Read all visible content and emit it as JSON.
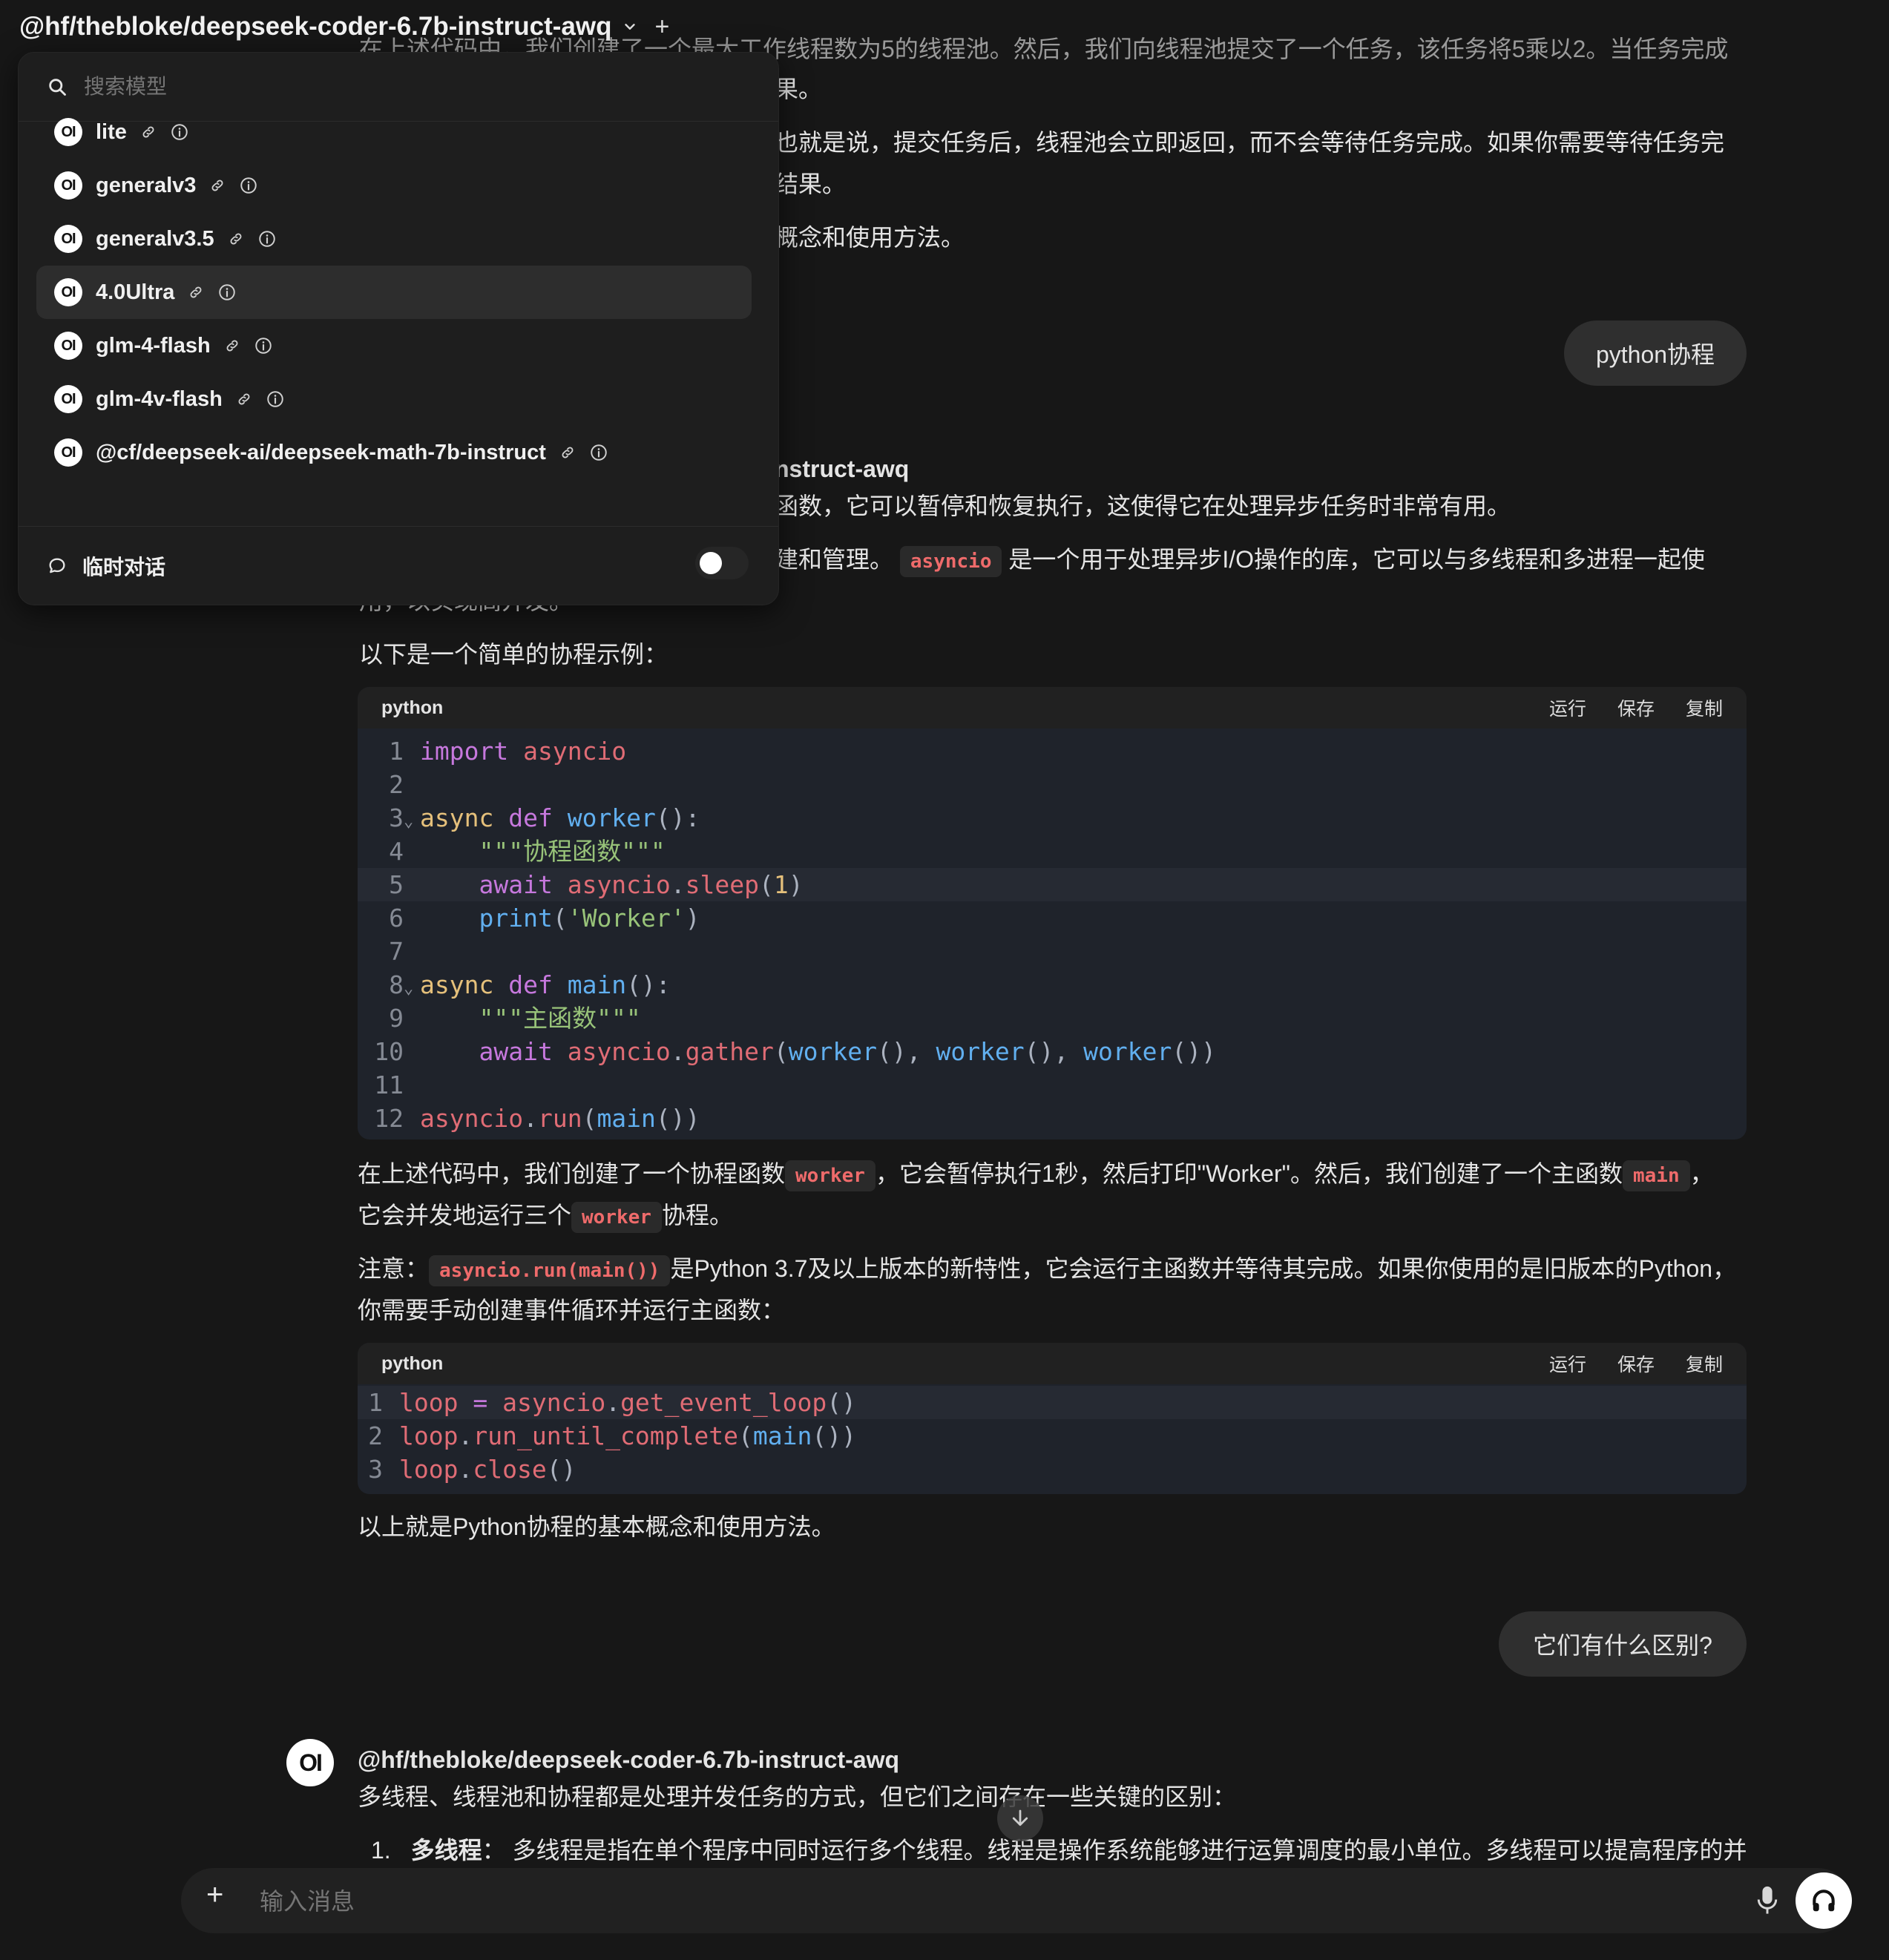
{
  "header": {
    "model_title": "@hf/thebloke/deepseek-coder-6.7b-instruct-awq",
    "add_symbol": "+"
  },
  "dropdown": {
    "search_placeholder": "搜索模型",
    "models": [
      {
        "name": "lite"
      },
      {
        "name": "generalv3"
      },
      {
        "name": "generalv3.5"
      },
      {
        "name": "4.0Ultra"
      },
      {
        "name": "glm-4-flash"
      },
      {
        "name": "glm-4v-flash"
      },
      {
        "name": "@cf/deepseek-ai/deepseek-math-7b-instruct"
      }
    ],
    "selected_model": "4.0Ultra",
    "temp_chat_label": "临时对话",
    "temp_chat_enabled": false,
    "logo_text": "OI"
  },
  "chat": {
    "prev_line1_tail": "在上述代码中，我们创建了一个最大工作线程数为5的线程池。然后，我们向线程池提交了一个任务，该任务将5乘以2。当任务完成",
    "prev_line2_tail": "果。",
    "prev_line3_tail": "也就是说，提交任务后，线程池会立即返回，而不会等待任务完成。如果你需要等待任务完",
    "prev_line4_tail": "结果。",
    "prev_line5_tail": "概念和使用方法。",
    "user_msg_1": "python协程",
    "assistant_name_tail": "nstruct-awq",
    "resp_line1_tail": "函数，它可以暂停和恢复执行，这使得它在处理异步任务时非常有用。",
    "resp_line2_tail": "建和管理。",
    "resp_line2_code": "asyncio",
    "resp_line2_rest": "是一个用于处理异步I/O操作的库，它可以与多线程和多进程一起使",
    "resp_line3": "用，以实现高并发。",
    "example_intro": "以下是一个简单的协程示例：",
    "code1": {
      "lang": "python",
      "actions": [
        "运行",
        "保存",
        "复制"
      ],
      "line_numbers": [
        "1",
        "2",
        "3",
        "4",
        "5",
        "6",
        "7",
        "8",
        "9",
        "10",
        "11",
        "12"
      ]
    },
    "explain_a1": "在上述代码中，我们创建了一个协程函数",
    "explain_code_worker": "worker",
    "explain_a2": "，它会暂停执行1秒，然后打印\"Worker\"。然后，我们创建了一个主函数",
    "explain_code_main": "main",
    "explain_a3": "，",
    "explain_b1": "它会并发地运行三个",
    "explain_code_worker2": "worker",
    "explain_b2": "协程。",
    "note_label": "注意：",
    "note_code": "asyncio.run(main())",
    "note_rest": "是Python 3.7及以上版本的新特性，它会运行主函数并等待其完成。如果你使用的是旧版本的Python，",
    "note_line2": "你需要手动创建事件循环并运行主函数：",
    "code2": {
      "lang": "python",
      "actions": [
        "运行",
        "保存",
        "复制"
      ],
      "line_numbers": [
        "1",
        "2",
        "3"
      ]
    },
    "summary": "以上就是Python协程的基本概念和使用方法。",
    "user_msg_2": "它们有什么区别?",
    "assistant_name": "@hf/thebloke/deepseek-coder-6.7b-instruct-awq",
    "answer_intro": "多线程、线程池和协程都是处理并发任务的方式，但它们之间存在一些关键的区别：",
    "answer_item1_num": "1.",
    "answer_item1_bold": "多线程",
    "answer_item1_text": "： 多线程是指在单个程序中同时运行多个线程。线程是操作系统能够进行运算调度的最小单位。多线程可以提高程序的并"
  },
  "input": {
    "placeholder": "输入消息",
    "plus": "+"
  },
  "icons": [
    "chevron-down-icon",
    "plus-icon",
    "search-icon",
    "link-icon",
    "info-icon",
    "chat-bubble-icon",
    "toggle-switch",
    "scroll-down-icon",
    "microphone-icon",
    "headphones-icon"
  ]
}
